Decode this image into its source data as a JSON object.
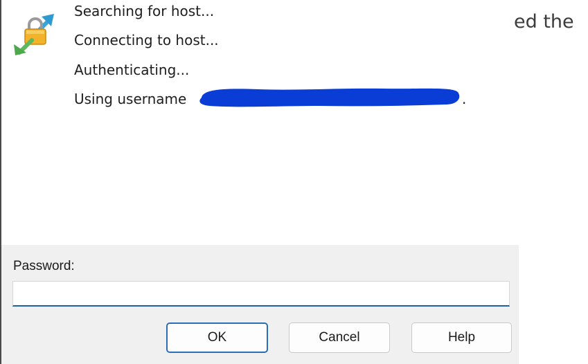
{
  "background": {
    "visible_text": "ed the"
  },
  "icon": {
    "name": "putty-key-exchange-icon"
  },
  "log": {
    "line1": "Searching for host...",
    "line2": "Connecting to host...",
    "line3": "Authenticating...",
    "line4_prefix": "Using username",
    "line4_suffix": "."
  },
  "dialog": {
    "password_label": "Password:",
    "password_value": "",
    "buttons": {
      "ok": "OK",
      "cancel": "Cancel",
      "help": "Help"
    }
  },
  "colors": {
    "redaction": "#0a3dd6",
    "panel": "#f0f0f0",
    "focus_accent": "#1f5f9e",
    "ok_border": "#2a6db5"
  }
}
